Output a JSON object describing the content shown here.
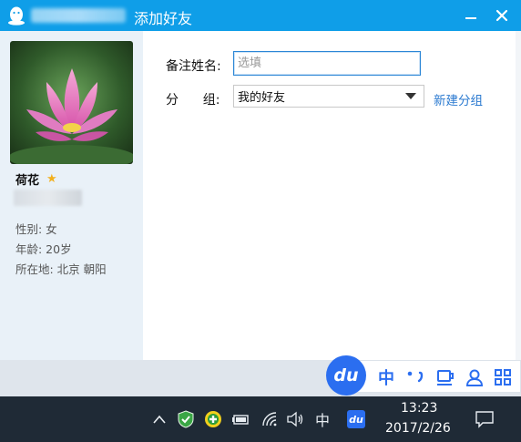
{
  "titlebar": {
    "title": "添加好友"
  },
  "profile": {
    "name": "荷花",
    "gender": "性别: 女",
    "age": "年龄: 20岁",
    "location": "所在地: 北京  朝阳"
  },
  "form": {
    "remark_label": "备注姓名:",
    "remark_placeholder": "选填",
    "group_label": "分      组:",
    "group_value": "我的好友",
    "new_group_link": "新建分组"
  },
  "ime": {
    "logo": "du",
    "lang": "中"
  },
  "taskbar": {
    "ime_indicator": "中",
    "time": "13:23",
    "date": "2017/2/26"
  },
  "colors": {
    "titlebar": "#0f9ee8",
    "link": "#2b7ad0",
    "taskbar": "#1f2a36",
    "ime_accent": "#2b6ef0"
  }
}
